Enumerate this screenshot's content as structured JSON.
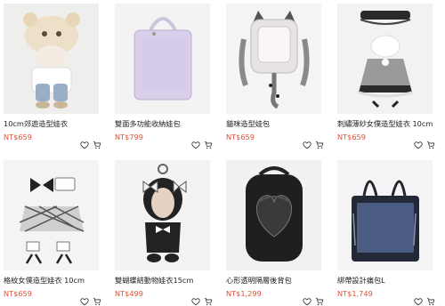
{
  "products": [
    {
      "name": "10cm郊遊造型娃衣",
      "price": "NT$659",
      "image": "doll-bear-hat-outfit"
    },
    {
      "name": "雙面多功能收納娃包",
      "price": "NT$799",
      "image": "purple-clear-pouch"
    },
    {
      "name": "貓咪造型娃包",
      "price": "NT$659",
      "image": "cat-ear-clear-bag"
    },
    {
      "name": "刺繡薄紗女僕造型娃衣 10cm",
      "price": "NT$659",
      "image": "lace-maid-outfit"
    },
    {
      "name": "格紋女僕造型娃衣 10cm",
      "price": "NT$659",
      "image": "plaid-maid-outfit"
    },
    {
      "name": "雙蝴蝶結動物娃衣15cm",
      "price": "NT$499",
      "image": "bow-animal-costume"
    },
    {
      "name": "心形透明隔層後背包",
      "price": "NT$1,299",
      "image": "heart-clear-backpack"
    },
    {
      "name": "綁帶設計痛包L",
      "price": "NT$1,749",
      "image": "navy-ita-tote"
    }
  ],
  "icons": {
    "wishlist": "heart-icon",
    "cart": "cart-icon"
  },
  "colors": {
    "price": "#e0513a",
    "text": "#222222",
    "thumb_bg": "#f1f1f1"
  }
}
